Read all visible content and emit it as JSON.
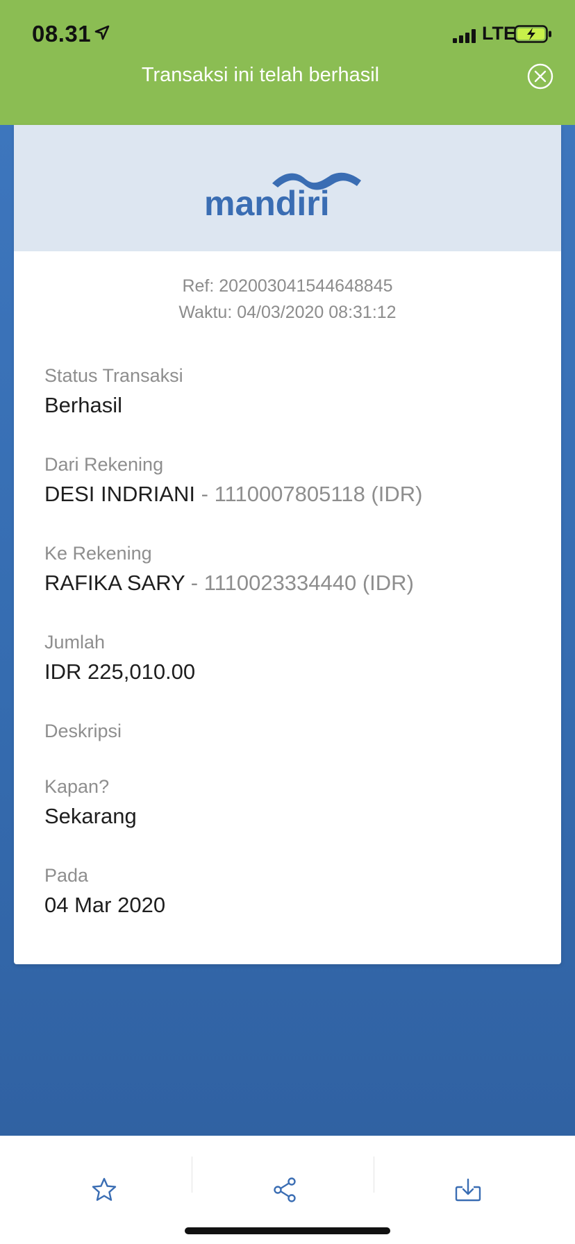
{
  "status_bar": {
    "time": "08.31",
    "network": "LTE"
  },
  "banner": {
    "message": "Transaksi ini telah berhasil"
  },
  "brand": {
    "logo_text": "mandiri",
    "colors": {
      "primary": "#3a6db3",
      "success_green": "#8bbd53"
    }
  },
  "receipt": {
    "ref": "Ref: 202003041544648845",
    "time": "Waktu: 04/03/2020 08:31:12",
    "fields": [
      {
        "label": "Status Transaksi",
        "value": "Berhasil"
      },
      {
        "label": "Dari Rekening",
        "name": "DESI INDRIANI",
        "account": " - 1110007805118 (IDR)"
      },
      {
        "label": "Ke Rekening",
        "name": "RAFIKA SARY",
        "account": " - 1110023334440 (IDR)"
      },
      {
        "label": "Jumlah",
        "value": "IDR 225,010.00"
      },
      {
        "label": "Deskripsi",
        "value": ""
      },
      {
        "label": "Kapan?",
        "value": "Sekarang"
      },
      {
        "label": "Pada",
        "value": "04 Mar 2020"
      }
    ]
  },
  "toolbar": {
    "icons": [
      "star-icon",
      "share-icon",
      "download-icon"
    ]
  }
}
